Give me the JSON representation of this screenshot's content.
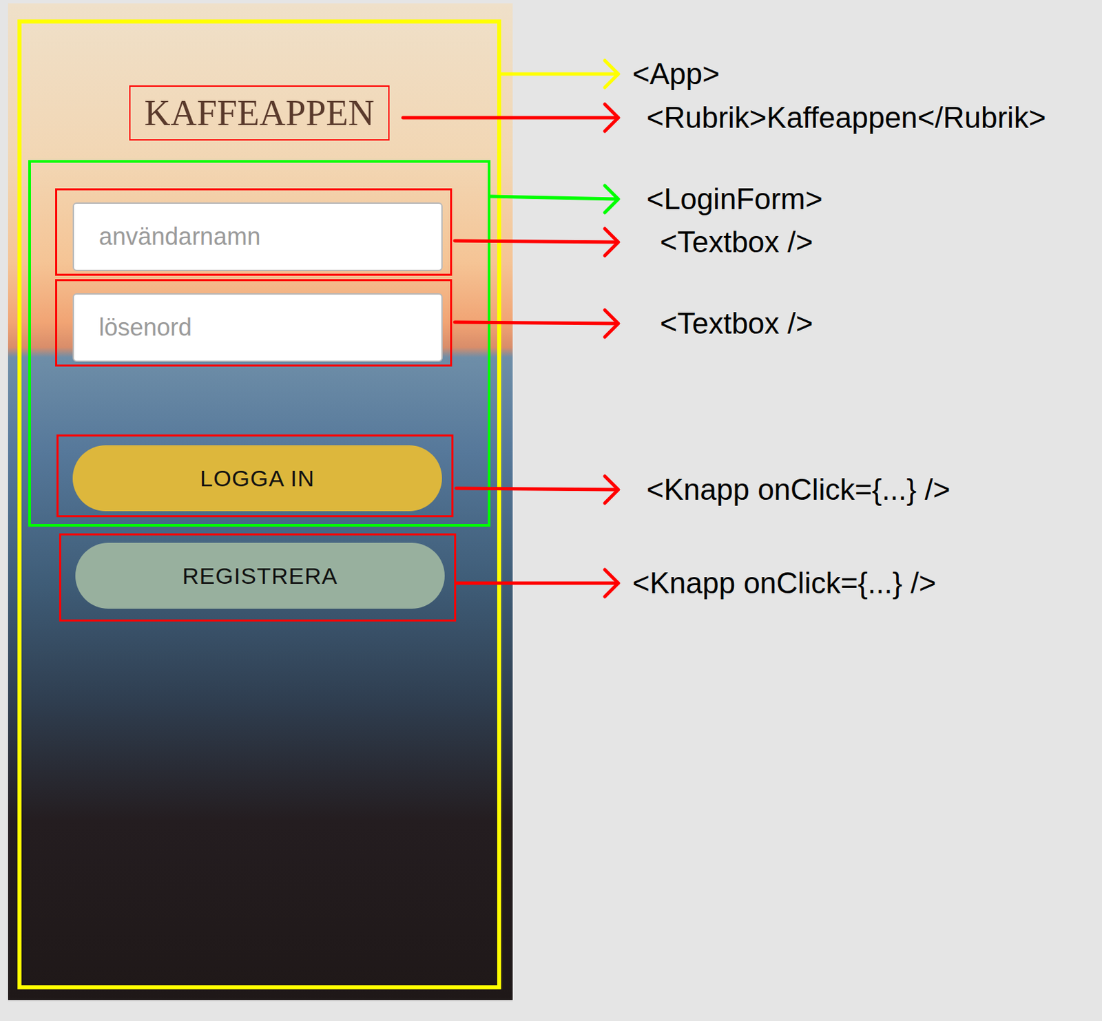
{
  "screen": {
    "title": "KAFFEAPPEN",
    "fields": [
      {
        "placeholder": "användarnamn"
      },
      {
        "placeholder": "lösenord"
      }
    ],
    "buttons": [
      {
        "label": "LOGGA IN",
        "color": "#ddb73c"
      },
      {
        "label": "REGISTRERA",
        "color": "#98b09e"
      }
    ]
  },
  "annotations": [
    {
      "label": "<App>",
      "color": "#ffff00"
    },
    {
      "label": "<Rubrik>Kaffeappen</Rubrik>",
      "color": "#ff0000"
    },
    {
      "label": "<LoginForm>",
      "color": "#00ff00"
    },
    {
      "label": "<Textbox />",
      "color": "#ff0000"
    },
    {
      "label": "<Textbox />",
      "color": "#ff0000"
    },
    {
      "label": "<Knapp onClick={...} />",
      "color": "#ff0000"
    },
    {
      "label": "<Knapp onClick={...} />",
      "color": "#ff0000"
    }
  ]
}
